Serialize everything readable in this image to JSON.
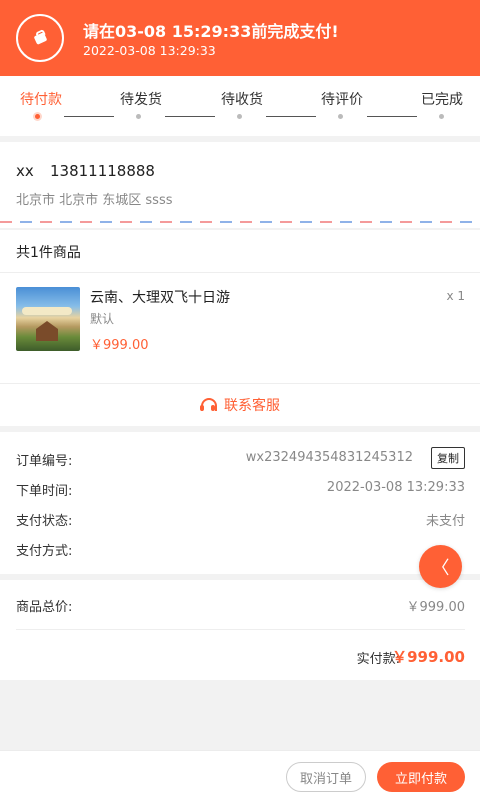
{
  "banner": {
    "icon": "wallet-icon",
    "title": "请在03-08 15:29:33前完成支付!",
    "time": "2022-03-08  13:29:33"
  },
  "steps": [
    {
      "label": "待付款",
      "active": true
    },
    {
      "label": "待发货",
      "active": false
    },
    {
      "label": "待收货",
      "active": false
    },
    {
      "label": "待评价",
      "active": false
    },
    {
      "label": "已完成",
      "active": false
    }
  ],
  "address": {
    "name": "xx",
    "phone": "13811118888",
    "detail": "北京市 北京市 东城区 ssss"
  },
  "goods": {
    "header": "共1件商品",
    "item": {
      "name": "云南、大理双飞十日游",
      "spec": "默认",
      "price": "￥999.00",
      "qty": "x 1"
    },
    "service_label": "联系客服",
    "service_icon": "headset-icon"
  },
  "order_info": {
    "number_label": "订单编号:",
    "number_value": "wx232494354831245312",
    "copy_label": "复制",
    "time_label": "下单时间:",
    "time_value": "2022-03-08 13:29:33",
    "status_label": "支付状态:",
    "status_value": "未支付",
    "method_label": "支付方式:",
    "method_value": ""
  },
  "float_button": {
    "icon": "chevron-left-icon",
    "glyph": "〈"
  },
  "totals": {
    "goods_total_label": "商品总价:",
    "goods_total_value": "￥999.00",
    "paid_label": "实付款:",
    "paid_value": "￥999.00"
  },
  "actions": {
    "cancel": "取消订单",
    "pay": "立即付款"
  },
  "colors": {
    "accent": "#ff6035",
    "background": "#f2f2f2"
  }
}
